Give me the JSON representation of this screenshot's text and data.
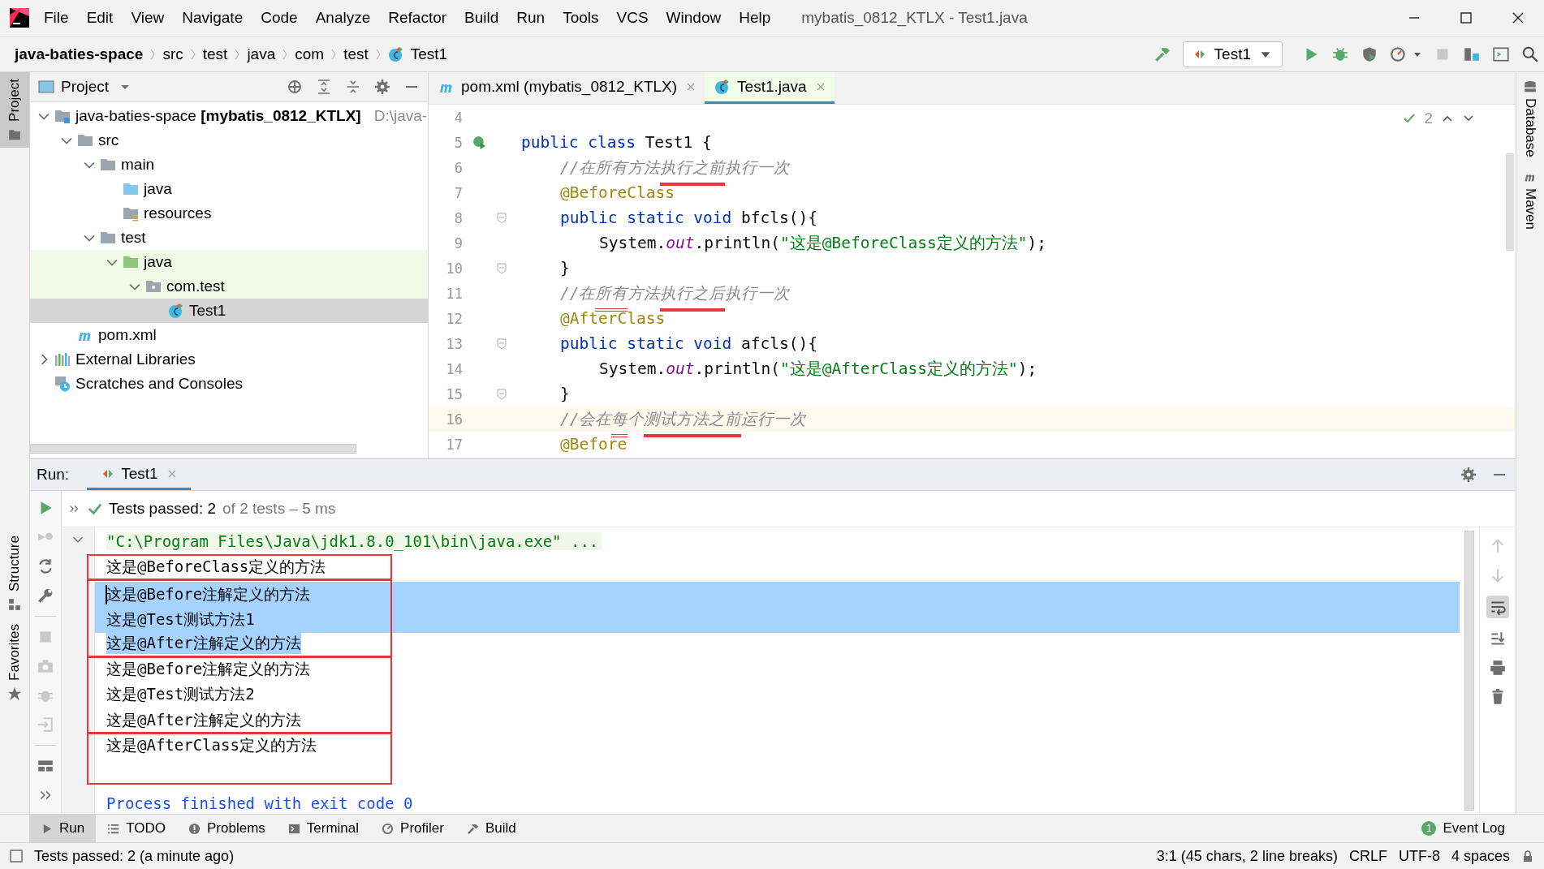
{
  "window": {
    "title": "mybatis_0812_KTLX - Test1.java"
  },
  "menu": [
    "File",
    "Edit",
    "View",
    "Navigate",
    "Code",
    "Analyze",
    "Refactor",
    "Build",
    "Run",
    "Tools",
    "VCS",
    "Window",
    "Help"
  ],
  "breadcrumbs": [
    {
      "label": "java-baties-space",
      "kind": "project"
    },
    {
      "label": "src",
      "kind": "dir"
    },
    {
      "label": "test",
      "kind": "dir"
    },
    {
      "label": "java",
      "kind": "dir"
    },
    {
      "label": "com",
      "kind": "dir"
    },
    {
      "label": "test",
      "kind": "dir"
    },
    {
      "label": "Test1",
      "kind": "class"
    }
  ],
  "run_config": "Test1",
  "left_stripe": [
    {
      "label": "Project",
      "selected": true,
      "kind": "project"
    },
    {
      "label": "Structure",
      "selected": false,
      "kind": "structure"
    },
    {
      "label": "Favorites",
      "selected": false,
      "kind": "favorites"
    }
  ],
  "right_stripe": [
    {
      "label": "Database",
      "kind": "database"
    },
    {
      "label": "Maven",
      "kind": "maven"
    }
  ],
  "project_panel": {
    "title": "Project",
    "tree": [
      {
        "label": "java-baties-space **[mybatis_0812_KTLX]**",
        "path": "D:\\java-",
        "kind": "module",
        "expanded": true,
        "selected": false,
        "highlighted": false,
        "children": [
          {
            "label": "src",
            "kind": "folder",
            "expanded": true,
            "selected": false,
            "highlighted": false,
            "children": [
              {
                "label": "main",
                "kind": "folder",
                "expanded": true,
                "selected": false,
                "highlighted": false,
                "children": [
                  {
                    "label": "java",
                    "kind": "source",
                    "selected": false,
                    "highlighted": false
                  },
                  {
                    "label": "resources",
                    "kind": "resources",
                    "selected": false,
                    "highlighted": false
                  }
                ]
              },
              {
                "label": "test",
                "kind": "folder",
                "expanded": true,
                "selected": false,
                "highlighted": false,
                "children": [
                  {
                    "label": "java",
                    "kind": "test",
                    "expanded": true,
                    "selected": false,
                    "highlighted": true,
                    "children": [
                      {
                        "label": "com.test",
                        "kind": "package",
                        "expanded": true,
                        "selected": false,
                        "highlighted": true,
                        "children": [
                          {
                            "label": "Test1",
                            "kind": "class",
                            "selected": true
                          }
                        ]
                      }
                    ]
                  }
                ]
              }
            ]
          },
          {
            "label": "pom.xml",
            "kind": "maven",
            "selected": false,
            "highlighted": false
          }
        ]
      },
      {
        "label": "External Libraries",
        "kind": "libraries",
        "expanded": false,
        "selected": false,
        "highlighted": false
      },
      {
        "label": "Scratches and Consoles",
        "kind": "scratches",
        "selected": false,
        "highlighted": false
      }
    ]
  },
  "editor": {
    "tabs": [
      {
        "label": "pom.xml (mybatis_0812_KTLX)",
        "kind": "maven",
        "selected": false
      },
      {
        "label": "Test1.java",
        "kind": "class",
        "selected": true
      }
    ],
    "inspection_count": "2",
    "lines": [
      {
        "number": "4",
        "current": false
      },
      {
        "number": "5",
        "current": false,
        "kind": "run",
        "tokens": [
          {
            "text": "public class ",
            "kind": "keyword"
          },
          {
            "text": "Test1 {",
            "kind": "plain"
          }
        ],
        "children": [
          {
            "number": "6",
            "current": false,
            "tokens": [
              {
                "text": "//在所有方法",
                "kind": "comment"
              },
              {
                "text": "执行之前",
                "kind": "comment",
                "underlined": true
              },
              {
                "text": "执行一次",
                "kind": "comment"
              }
            ]
          },
          {
            "number": "7",
            "current": false,
            "tokens": [
              {
                "text": "@BeforeClass",
                "kind": "annotation"
              }
            ]
          },
          {
            "number": "8",
            "current": false,
            "kind": "fold",
            "tokens": [
              {
                "text": "public static void ",
                "kind": "keyword"
              },
              {
                "text": "bfcls",
                "kind": "plain"
              },
              {
                "text": "(){",
                "kind": "plain"
              }
            ],
            "children": [
              {
                "number": "9",
                "current": false,
                "tokens": [
                  {
                    "text": "System.",
                    "kind": "plain"
                  },
                  {
                    "text": "out",
                    "kind": "field"
                  },
                  {
                    "text": ".println(",
                    "kind": "plain"
                  },
                  {
                    "text": "\"这是@BeforeClass定义的方法\"",
                    "kind": "string"
                  },
                  {
                    "text": ");",
                    "kind": "plain"
                  }
                ]
              }
            ]
          },
          {
            "number": "10",
            "current": false,
            "kind": "fold",
            "tokens": [
              {
                "text": "}",
                "kind": "plain"
              }
            ]
          },
          {
            "number": "11",
            "current": false,
            "tokens": [
              {
                "text": "//在",
                "kind": "comment"
              },
              {
                "text": "所有",
                "kind": "comment",
                "boxed": true
              },
              {
                "text": "方法",
                "kind": "comment"
              },
              {
                "text": "执行之后",
                "kind": "comment",
                "underlined": true
              },
              {
                "text": "执行一次",
                "kind": "comment"
              }
            ]
          },
          {
            "number": "12",
            "current": false,
            "tokens": [
              {
                "text": "@AfterClass",
                "kind": "annotation"
              }
            ]
          },
          {
            "number": "13",
            "current": false,
            "kind": "fold",
            "tokens": [
              {
                "text": "public static void ",
                "kind": "keyword"
              },
              {
                "text": "afcls",
                "kind": "plain"
              },
              {
                "text": "(){",
                "kind": "plain"
              }
            ],
            "children": [
              {
                "number": "14",
                "current": false,
                "tokens": [
                  {
                    "text": "System.",
                    "kind": "plain"
                  },
                  {
                    "text": "out",
                    "kind": "field"
                  },
                  {
                    "text": ".println(",
                    "kind": "plain"
                  },
                  {
                    "text": "\"这是@AfterClass定义的方法\"",
                    "kind": "string"
                  },
                  {
                    "text": ");",
                    "kind": "plain"
                  }
                ]
              }
            ]
          },
          {
            "number": "15",
            "current": false,
            "kind": "fold",
            "tokens": [
              {
                "text": "}",
                "kind": "plain"
              }
            ]
          },
          {
            "number": "16",
            "current": true,
            "tokens": [
              {
                "text": "//会在",
                "kind": "comment"
              },
              {
                "text": "每",
                "kind": "comment",
                "boxed": true
              },
              {
                "text": "个",
                "kind": "comment"
              },
              {
                "text": "测试方法之前",
                "kind": "comment",
                "underlined": true
              },
              {
                "text": "运行一次",
                "kind": "comment"
              }
            ]
          },
          {
            "number": "17",
            "current": false,
            "tokens": [
              {
                "text": "@Before",
                "kind": "annotation"
              }
            ]
          }
        ]
      }
    ]
  },
  "run_panel": {
    "label": "Run:",
    "tab": "Test1",
    "status": "Tests passed: 2",
    "status_detail": "of 2 tests – 5 ms",
    "groups": [
      {
        "boxed": false,
        "lines": [
          {
            "text": "\"C:\\Program Files\\Java\\jdk1.8.0_101\\bin\\java.exe\" ...",
            "kind": "command",
            "selected": false
          }
        ]
      },
      {
        "boxed": true,
        "lines": [
          {
            "text": "这是@BeforeClass定义的方法",
            "kind": "output",
            "selected": false
          }
        ]
      },
      {
        "boxed": true,
        "lines": [
          {
            "text": "这是@Before注解定义的方法",
            "kind": "output",
            "selected": true,
            "caret": true
          },
          {
            "text": "这是@Test测试方法1",
            "kind": "output",
            "selected": true
          },
          {
            "text": "这是@After注解定义的方法",
            "kind": "output",
            "selected": true,
            "partial": true
          }
        ]
      },
      {
        "boxed": true,
        "lines": [
          {
            "text": "这是@Before注解定义的方法",
            "kind": "output",
            "selected": false
          },
          {
            "text": "这是@Test测试方法2",
            "kind": "output",
            "selected": false
          },
          {
            "text": "这是@After注解定义的方法",
            "kind": "output",
            "selected": false
          }
        ]
      },
      {
        "boxed": true,
        "lines": [
          {
            "text": "这是@AfterClass定义的方法",
            "kind": "output",
            "selected": false
          },
          {
            "kind": "blank",
            "selected": false
          }
        ]
      },
      {
        "boxed": false,
        "lines": [
          {
            "text": "Process finished with exit code 0",
            "kind": "exit",
            "selected": false
          }
        ]
      }
    ]
  },
  "tool_windows": [
    {
      "label": "Run",
      "kind": "run",
      "selected": true
    },
    {
      "label": "TODO",
      "kind": "todo",
      "selected": false
    },
    {
      "label": "Problems",
      "kind": "problems",
      "selected": false
    },
    {
      "label": "Terminal",
      "kind": "terminal",
      "selected": false
    },
    {
      "label": "Profiler",
      "kind": "profiler",
      "selected": false
    },
    {
      "label": "Build",
      "kind": "build",
      "selected": false
    }
  ],
  "event_log": {
    "label": "Event Log",
    "count": "1"
  },
  "status_bar": {
    "message": "Tests passed: 2 (a minute ago)",
    "position": "3:1 (45 chars, 2 line breaks)",
    "line_separator": "CRLF",
    "encoding": "UTF-8",
    "indent": "4 spaces"
  }
}
